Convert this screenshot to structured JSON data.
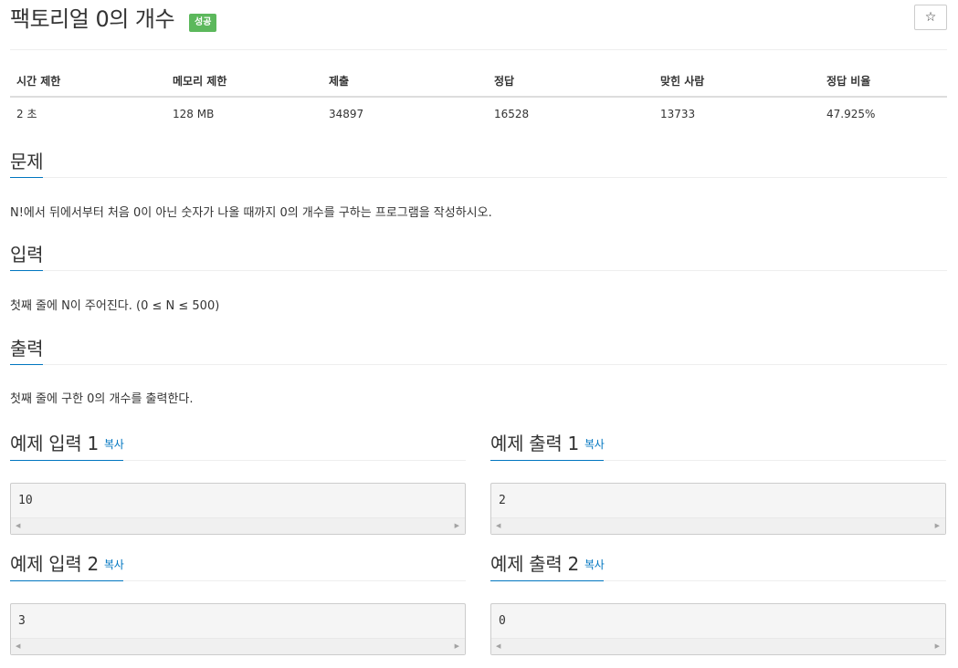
{
  "problem": {
    "title": "팩토리얼 0의 개수",
    "status_badge": "성공",
    "star_label": "☆"
  },
  "info": {
    "headers": [
      "시간 제한",
      "메모리 제한",
      "제출",
      "정답",
      "맞힌 사람",
      "정답 비율"
    ],
    "values": [
      "2 초",
      "128 MB",
      "34897",
      "16528",
      "13733",
      "47.925%"
    ]
  },
  "sections": {
    "problem_heading": "문제",
    "problem_text": "N!에서 뒤에서부터 처음 0이 아닌 숫자가 나올 때까지 0의 개수를 구하는 프로그램을 작성하시오.",
    "input_heading": "입력",
    "input_text": "첫째 줄에 N이 주어진다. (0 ≤ N ≤ 500)",
    "output_heading": "출력",
    "output_text": "첫째 줄에 구한 0의 개수를 출력한다."
  },
  "samples": {
    "copy_label": "복사",
    "input1_heading": "예제 입력 1",
    "input1_value": "10",
    "output1_heading": "예제 출력 1",
    "output1_value": "2",
    "input2_heading": "예제 입력 2",
    "input2_value": "3",
    "output2_heading": "예제 출력 2",
    "output2_value": "0"
  },
  "icons": {
    "scroll_left": "◀",
    "scroll_right": "▶"
  }
}
